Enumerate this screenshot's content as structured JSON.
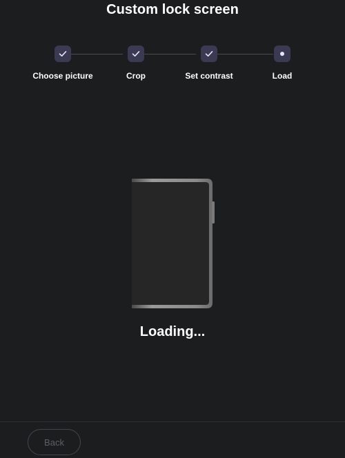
{
  "header": {
    "title": "Custom lock screen"
  },
  "stepper": {
    "steps": [
      {
        "label": "Choose picture",
        "state": "completed",
        "icon": "check-icon"
      },
      {
        "label": "Crop",
        "state": "completed",
        "icon": "check-icon"
      },
      {
        "label": "Set contrast",
        "state": "completed",
        "icon": "check-icon"
      },
      {
        "label": "Load",
        "state": "current",
        "icon": "dot-icon"
      }
    ]
  },
  "main": {
    "status_text": "Loading...",
    "illustration_icon": "phone-icon"
  },
  "footer": {
    "back_label": "Back"
  },
  "colors": {
    "background": "#1c1d1f",
    "step_fill": "#3a3a52",
    "step_icon": "#e6e4ff",
    "text": "#ffffff",
    "muted": "#5e5f64"
  }
}
